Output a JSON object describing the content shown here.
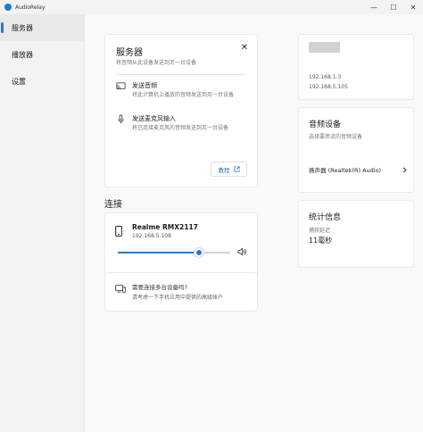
{
  "window": {
    "title": "AudioRelay",
    "controls": {
      "minimize": "—",
      "maximize": "☐",
      "close": "✕"
    }
  },
  "sidebar": {
    "items": [
      {
        "label": "服务器",
        "active": true
      },
      {
        "label": "播放器",
        "active": false
      },
      {
        "label": "设置",
        "active": false
      }
    ]
  },
  "server_card": {
    "title": "服务器",
    "subtitle": "将音频从此设备发送到另一台设备",
    "close_icon": "close-icon",
    "features": [
      {
        "icon": "cast-icon",
        "title": "发送音频",
        "description": "将此计算机上播放的音频发送到另一台设备"
      },
      {
        "icon": "microphone-icon",
        "title": "发送麦克风输入",
        "description": "将已连接麦克风的音频发送到另一台设备"
      }
    ],
    "tutorial_button": "教程",
    "tutorial_icon": "external-link-icon"
  },
  "connection": {
    "section_label": "连接",
    "device_name": "Realme RMX2117",
    "device_ip": "192.168.5.108",
    "volume": 0.72,
    "speaker_icon": "speaker-icon"
  },
  "multi_device": {
    "title": "需要连接多台设备吗?",
    "description": "请考虑一下手机应用中提供的高级账户"
  },
  "ip_card": {
    "addresses": [
      "192.168.1.3",
      "192.168.5.105"
    ]
  },
  "audio_device_card": {
    "title": "音频设备",
    "subtitle": "选择要串流的音频设备",
    "selected_device": "扬声器 (Realtek(R) Audio)"
  },
  "stats_card": {
    "title": "统计信息",
    "latency_label": "捕获延迟",
    "latency_value": "11毫秒"
  },
  "colors": {
    "accent": "#1f7ad6",
    "link": "#1f6fbf"
  }
}
